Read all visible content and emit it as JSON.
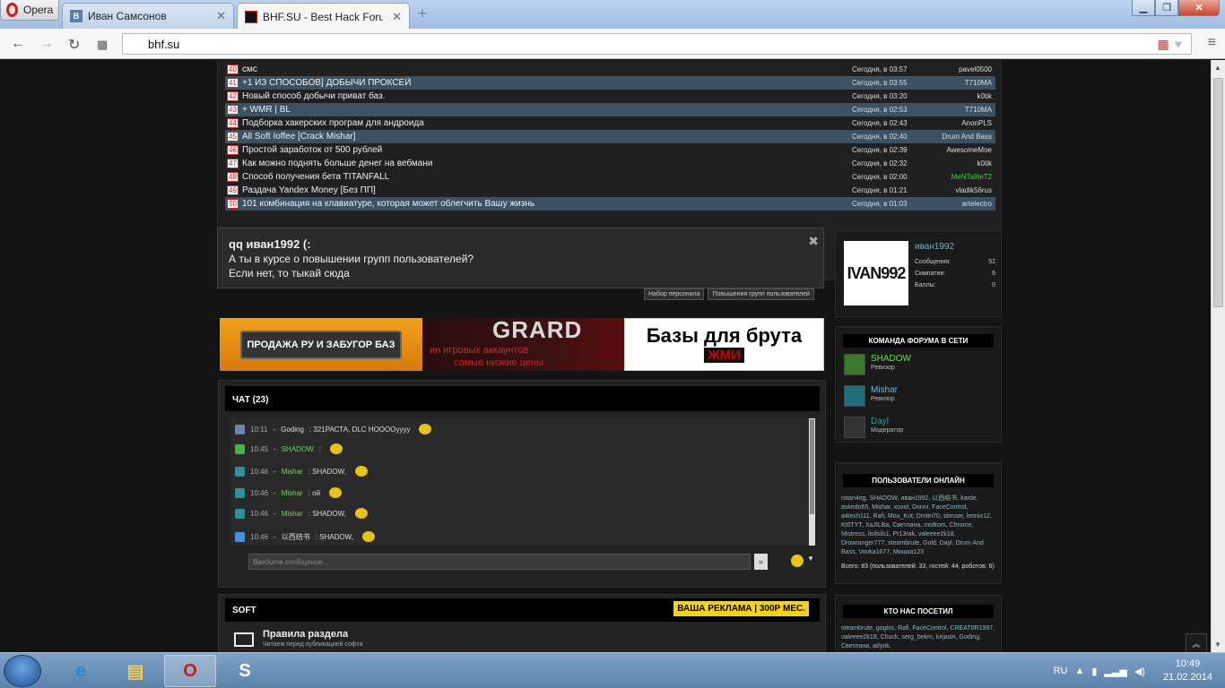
{
  "browser": {
    "opera_label": "Opera",
    "tabs": [
      {
        "label": "Иван Самсонов",
        "icon": "В",
        "icon_color": "#5b7fa6"
      },
      {
        "label": "BHF.SU - Best Hack Forum",
        "icon": "",
        "icon_color": "#111111"
      }
    ],
    "url": "bhf.su"
  },
  "topics": [
    {
      "n": "40",
      "title": "смс",
      "time": "Сегодня, в 03:57",
      "author": "pavel0500",
      "alt": false
    },
    {
      "n": "41",
      "title": "+1 ИЗ СПОСОБОВ] ДОБЫЧИ ПРОКСЕЙ",
      "time": "Сегодня, в 03:55",
      "author": "T710MA",
      "alt": true
    },
    {
      "n": "42",
      "title": "Новый способ добычи приват баз.",
      "time": "Сегодня, в 03:20",
      "author": "k0tik",
      "alt": false
    },
    {
      "n": "43",
      "title": "+ WMR | BL",
      "time": "Сегодня, в 02:53",
      "author": "T710MA",
      "alt": true
    },
    {
      "n": "44",
      "title": "Подборка хакерских програм для андроида",
      "time": "Сегодня, в 02:43",
      "author": "AnonPLS",
      "alt": false
    },
    {
      "n": "45",
      "title": "All Soft Ioffee [Crack Mishar]",
      "time": "Сегодня, в 02:40",
      "author": "Drum And Bass",
      "alt": true
    },
    {
      "n": "46",
      "title": "Простой заработок от 500 рублей",
      "time": "Сегодня, в 02:39",
      "author": "AwesomeMoe",
      "alt": false
    },
    {
      "n": "47",
      "title": "Как можно поднять больше денег на вебмани",
      "time": "Сегодня, в 02:32",
      "author": "k0tik",
      "alt": false
    },
    {
      "n": "48",
      "title": "Способ получения бета TITANFALL",
      "time": "Сегодня, в 02:00",
      "author": "MeNTalIteT2",
      "alt": false,
      "green": true
    },
    {
      "n": "49",
      "title": "Раздача Yandex Money [Без ПП]",
      "time": "Сегодня, в 01:21",
      "author": "vladik56rus",
      "alt": false
    },
    {
      "n": "50",
      "title": "101 комбинация на клавиатуре, которая может облегчить Вашу жизнь",
      "time": "Сегодня, в 01:03",
      "author": "artelectro",
      "alt": true
    }
  ],
  "notice": {
    "title": "qq иван1992 (:",
    "line1": "А ты в курсе о повышении групп пользователей?",
    "line2": "Если нет, то тыкай сюда",
    "btn1": "Набор персонала",
    "btn2": "Повышения групп пользователей"
  },
  "banners": {
    "b1": "ПРОДАЖА РУ И ЗАБУГОР БАЗ",
    "b2_title": "GRARD",
    "b2_l1": "ин игровых аккаунтов",
    "b2_l2": "самые низкие цены",
    "b3_l1": "Базы для брута",
    "b3_l2": "ЖМИ"
  },
  "chat": {
    "title": "ЧАТ (23)",
    "messages": [
      {
        "time": "10:11",
        "name": "Goding",
        "text": ": 321РАСТА, DLC НОООOyyyy",
        "green": false,
        "ava": "#6a86a8"
      },
      {
        "time": "10:45",
        "name": "SHADOW",
        "text": ":",
        "green": true,
        "ava": "#4caf50"
      },
      {
        "time": "10:46",
        "name": "Mishar",
        "text": ": SHADOW,",
        "green": true,
        "ava": "#2f8f9d"
      },
      {
        "time": "10:46",
        "name": "Mishar",
        "text": ": ой",
        "green": true,
        "ava": "#2f8f9d"
      },
      {
        "time": "10:46",
        "name": "Mishar",
        "text": ": SHADOW,",
        "green": true,
        "ava": "#2f8f9d"
      },
      {
        "time": "10:46",
        "name": "以西结书",
        "text": ": SHADOW,",
        "green": false,
        "ava": "#4a90d9"
      }
    ],
    "placeholder": "Введите сообщение...",
    "send": "»"
  },
  "soft": {
    "title": "SOFT",
    "ad": "ВАША РЕКЛАМА | 300Р МЕС.",
    "rules_title": "Правила раздела",
    "rules_sub": "Читаем перед публикацией софта"
  },
  "profile": {
    "avatar_text": "IVAN992",
    "name": "иван1992",
    "stats": [
      {
        "label": "Сообщения:",
        "value": "52"
      },
      {
        "label": "Симпатии:",
        "value": "6"
      },
      {
        "label": "Баллы:",
        "value": "0"
      }
    ]
  },
  "team": {
    "title": "КОМАНДА ФОРУМА В СЕТИ",
    "members": [
      {
        "name": "SHADOW",
        "role": "Ревизор",
        "color": "#66e04a",
        "ava": "#3b7a2b"
      },
      {
        "name": "Mishar",
        "role": "Ревизор",
        "color": "#5bc0de",
        "ava": "#1e6f7a"
      },
      {
        "name": "Dayl",
        "role": "Модератор",
        "color": "#2fa39b",
        "ava": "#333333"
      }
    ]
  },
  "online": {
    "title": "ПОЛЬЗОВАТЕЛИ ОНЛАЙН",
    "list": "rotan4eg, SHADOW, иван1992, 以西结书, karde, askedo65, Mishar, xoxol, Donni, FaceControl, a4tech111, Rafi, Mou_Kot, Dmitri70, stimser, leonix12, Kt0TYT, XaJILBa, Светлана, molkom, Chrome, Mistress, lisilsils1, Pr13rak, valeeee2k18, Drowranger777, steambrute, Gold, Dayl, Drum And Bass, Vovka1677, Мишка123",
    "total": "Всего: 83 (пользователей: 33, гостей: 44, роботов: 6)"
  },
  "visited": {
    "title": "КТО НАС ПОСЕТИЛ",
    "list": "steambrute, gogixs, Rafi, FaceControl, CREAT0R1997, valeeee2k18, Chuck, serg_bekm, kirjasin, Goding, Светлана, adyok,"
  },
  "taskbar": {
    "lang": "RU",
    "time": "10:49",
    "date": "21.02.2014"
  }
}
